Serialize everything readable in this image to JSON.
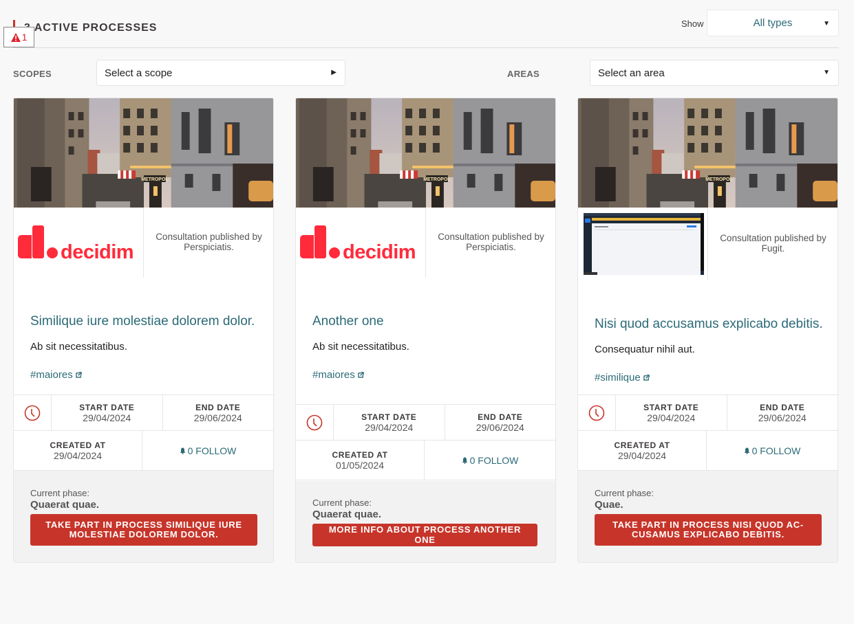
{
  "header": {
    "title": "3 Active Processes",
    "alert_count": "1",
    "show_label": "Show",
    "type_select_value": "All types"
  },
  "filters": {
    "scopes_label": "Scopes",
    "scope_value": "Select a scope",
    "areas_label": "Areas",
    "area_value": "Select an area"
  },
  "colors": {
    "accent": "#c7352a",
    "link": "#2b6a77",
    "logo": "#ff2b3b"
  },
  "cards": [
    {
      "image": "street-photo",
      "logo": "decidim",
      "logo_text": "decidim",
      "publisher": "Consultation published by Perspiciatis.",
      "title": "Similique iure molestiae dolorem dolor.",
      "description": "Ab sit necessitatibus.",
      "hashtag": "#maiores",
      "start_date_label": "Start date",
      "start_date": "29/04/2024",
      "end_date_label": "End date",
      "end_date": "29/06/2024",
      "created_label": "Created at",
      "created_at": "29/04/2024",
      "follow": "0 FOLLOW",
      "phase_label": "Current phase:",
      "phase": "Quaerat quae.",
      "cta": "Take part in process Similique iure molestiae dolorem dolor."
    },
    {
      "image": "street-photo",
      "logo": "decidim",
      "logo_text": "decidim",
      "publisher": "Consultation published by Perspiciatis.",
      "title": "Another one",
      "description": "Ab sit necessitatibus.",
      "hashtag": "#maiores",
      "start_date_label": "Start date",
      "start_date": "29/04/2024",
      "end_date_label": "End date",
      "end_date": "29/06/2024",
      "created_label": "Created at",
      "created_at": "01/05/2024",
      "follow": "0 FOLLOW",
      "phase_label": "Current phase:",
      "phase": "Quaerat quae.",
      "cta": "More info about process Another one"
    },
    {
      "image": "street-photo",
      "logo": "admin-screenshot",
      "publisher": "Consultation published by Fugit.",
      "title": "Nisi quod accusamus explicabo debitis.",
      "description": "Consequatur nihil aut.",
      "hashtag": "#similique",
      "start_date_label": "Start date",
      "start_date": "29/04/2024",
      "end_date_label": "End date",
      "end_date": "29/06/2024",
      "created_label": "Created at",
      "created_at": "29/04/2024",
      "follow": "0 FOLLOW",
      "phase_label": "Current phase:",
      "phase": "Quae.",
      "cta": "Take part in process Nisi quod ac-cusamus explicabo debitis."
    }
  ]
}
